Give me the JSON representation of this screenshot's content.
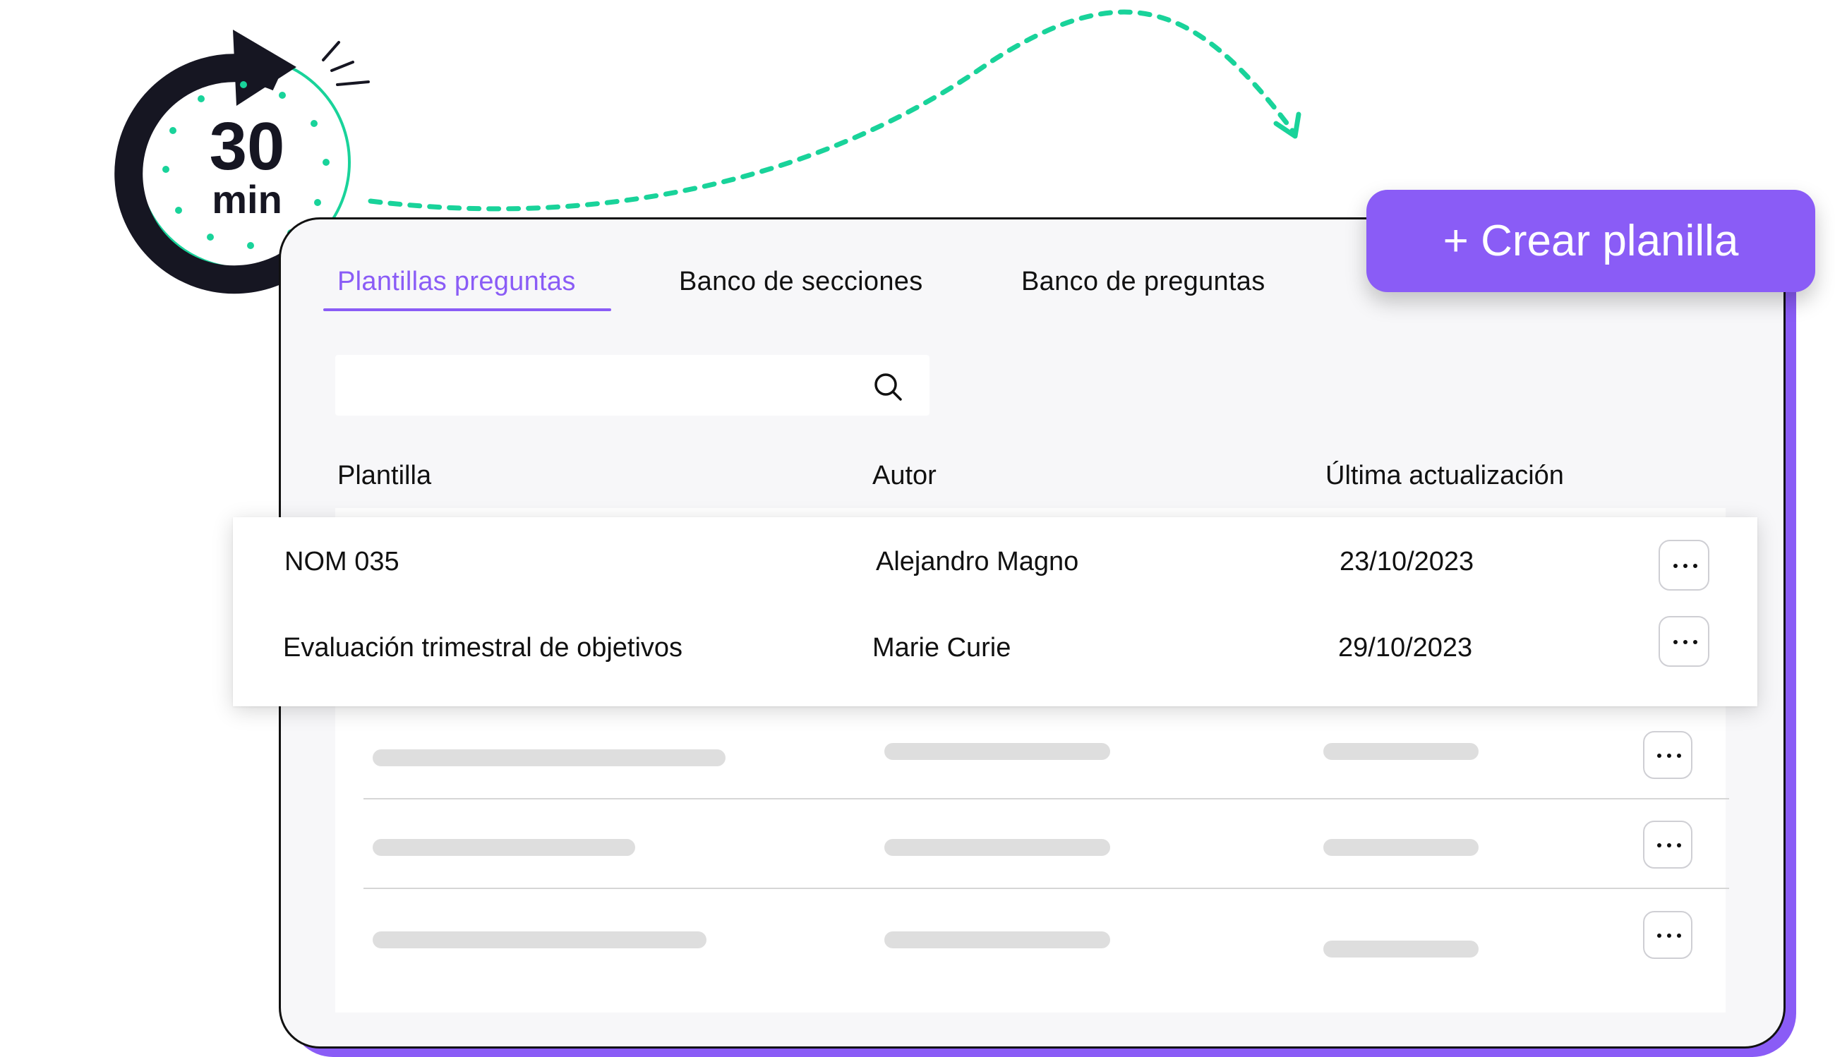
{
  "timer": {
    "number": "30",
    "unit": "min"
  },
  "create_button": {
    "label": "+ Crear planilla"
  },
  "tabs": [
    {
      "label": "Plantillas preguntas",
      "active": true
    },
    {
      "label": "Banco de secciones",
      "active": false
    },
    {
      "label": "Banco de preguntas",
      "active": false
    }
  ],
  "search": {
    "placeholder": "",
    "icon": "search-icon"
  },
  "table": {
    "headers": [
      "Plantilla",
      "Autor",
      "Última actualización"
    ],
    "rows": [
      {
        "template": "NOM 035",
        "author": "Alejandro Magno",
        "updated": "23/10/2023"
      },
      {
        "template": "Evaluación trimestral de objetivos",
        "author": "Marie Curie",
        "updated": "29/10/2023"
      }
    ],
    "placeholder_rows": 3
  },
  "colors": {
    "accent": "#8a5cf6",
    "timer_green": "#19d39a",
    "dark": "#161622",
    "skeleton": "#dedede"
  }
}
